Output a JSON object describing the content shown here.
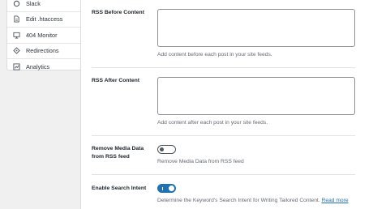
{
  "sidebar": {
    "items": [
      {
        "label": "Slack",
        "icon": "hash-icon"
      },
      {
        "label": "Edit .htaccess",
        "icon": "file-icon"
      },
      {
        "label": "404 Monitor",
        "icon": "monitor-icon"
      },
      {
        "label": "Redirections",
        "icon": "redirect-icon"
      },
      {
        "label": "Analytics",
        "icon": "analytics-icon"
      }
    ]
  },
  "settings": {
    "rss_before": {
      "label": "RSS Before Content",
      "value": "",
      "description": "Add content before each post in your site feeds."
    },
    "rss_after": {
      "label": "RSS After Content",
      "value": "",
      "description": "Add content after each post in your site feeds."
    },
    "remove_media": {
      "label": "Remove Media Data from RSS feed",
      "enabled": false,
      "description": "Remove Media Data from RSS feed"
    },
    "search_intent": {
      "label": "Enable Search Intent",
      "enabled": true,
      "description": "Determine the Keyword's Search Intent for Writing Tailored Content.",
      "link_text": "Read more"
    }
  },
  "colors": {
    "accent": "#2271b1",
    "text": "#1d2327",
    "muted": "#646970"
  }
}
